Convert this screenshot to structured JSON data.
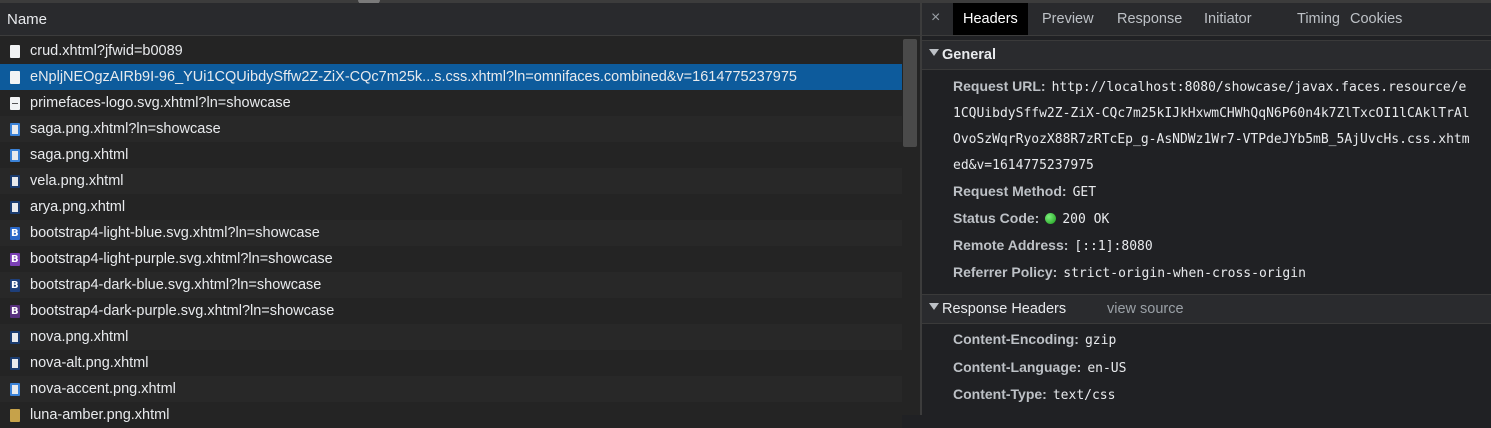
{
  "network_list": {
    "column_header": "Name",
    "selected_index": 1,
    "rows": [
      {
        "name": "crud.xhtml?jfwid=b0089",
        "icon": "document-icon"
      },
      {
        "name": "eNpljNEOgzAIRb9I-96_YUi1CQUibdySffw2Z-ZiX-CQc7m25k...s.css.xhtml?ln=omnifaces.combined&v=1614775237975",
        "icon": "document-icon"
      },
      {
        "name": "primefaces-logo.svg.xhtml?ln=showcase",
        "icon": "svg-image-icon"
      },
      {
        "name": "saga.png.xhtml?ln=showcase",
        "icon": "image-icon"
      },
      {
        "name": "saga.png.xhtml",
        "icon": "image-icon"
      },
      {
        "name": "vela.png.xhtml",
        "icon": "image-icon"
      },
      {
        "name": "arya.png.xhtml",
        "icon": "image-icon"
      },
      {
        "name": "bootstrap4-light-blue.svg.xhtml?ln=showcase",
        "icon": "bootstrap-icon"
      },
      {
        "name": "bootstrap4-light-purple.svg.xhtml?ln=showcase",
        "icon": "bootstrap-icon"
      },
      {
        "name": "bootstrap4-dark-blue.svg.xhtml?ln=showcase",
        "icon": "bootstrap-icon"
      },
      {
        "name": "bootstrap4-dark-purple.svg.xhtml?ln=showcase",
        "icon": "bootstrap-icon"
      },
      {
        "name": "nova.png.xhtml",
        "icon": "image-icon"
      },
      {
        "name": "nova-alt.png.xhtml",
        "icon": "image-icon"
      },
      {
        "name": "nova-accent.png.xhtml",
        "icon": "image-icon"
      },
      {
        "name": "luna-amber.png.xhtml",
        "icon": "image-icon"
      }
    ]
  },
  "details": {
    "close_glyph": "×",
    "tabs": [
      "Headers",
      "Preview",
      "Response",
      "Initiator",
      "Timing",
      "Cookies"
    ],
    "active_tab": "Headers",
    "general": {
      "title": "General",
      "request_url_label": "Request URL:",
      "request_url_lines": [
        "http://localhost:8080/showcase/javax.faces.resource/e",
        "1CQUibdySffw2Z-ZiX-CQc7m25kIJkHxwmCHWhQqN6P60n4k7ZlTxcOI1lCAklTrAl",
        "OvoSzWqrRyozX88R7zRTcEp_g-AsNDWz1Wr7-VTPdeJYb5mB_5AjUvcHs.css.xhtm",
        "ed&v=1614775237975"
      ],
      "request_method_label": "Request Method:",
      "request_method": "GET",
      "status_code_label": "Status Code:",
      "status_code": "200 OK",
      "remote_address_label": "Remote Address:",
      "remote_address": "[::1]:8080",
      "referrer_policy_label": "Referrer Policy:",
      "referrer_policy": "strict-origin-when-cross-origin"
    },
    "response_headers": {
      "title": "Response Headers",
      "view_source": "view source",
      "content_encoding_label": "Content-Encoding:",
      "content_encoding": "gzip",
      "content_language_label": "Content-Language:",
      "content_language": "en-US",
      "content_type_label": "Content-Type:",
      "content_type": "text/css"
    }
  },
  "colors": {
    "selected_row": "#0d5b9c",
    "status_ok": "#1a9a1a"
  }
}
